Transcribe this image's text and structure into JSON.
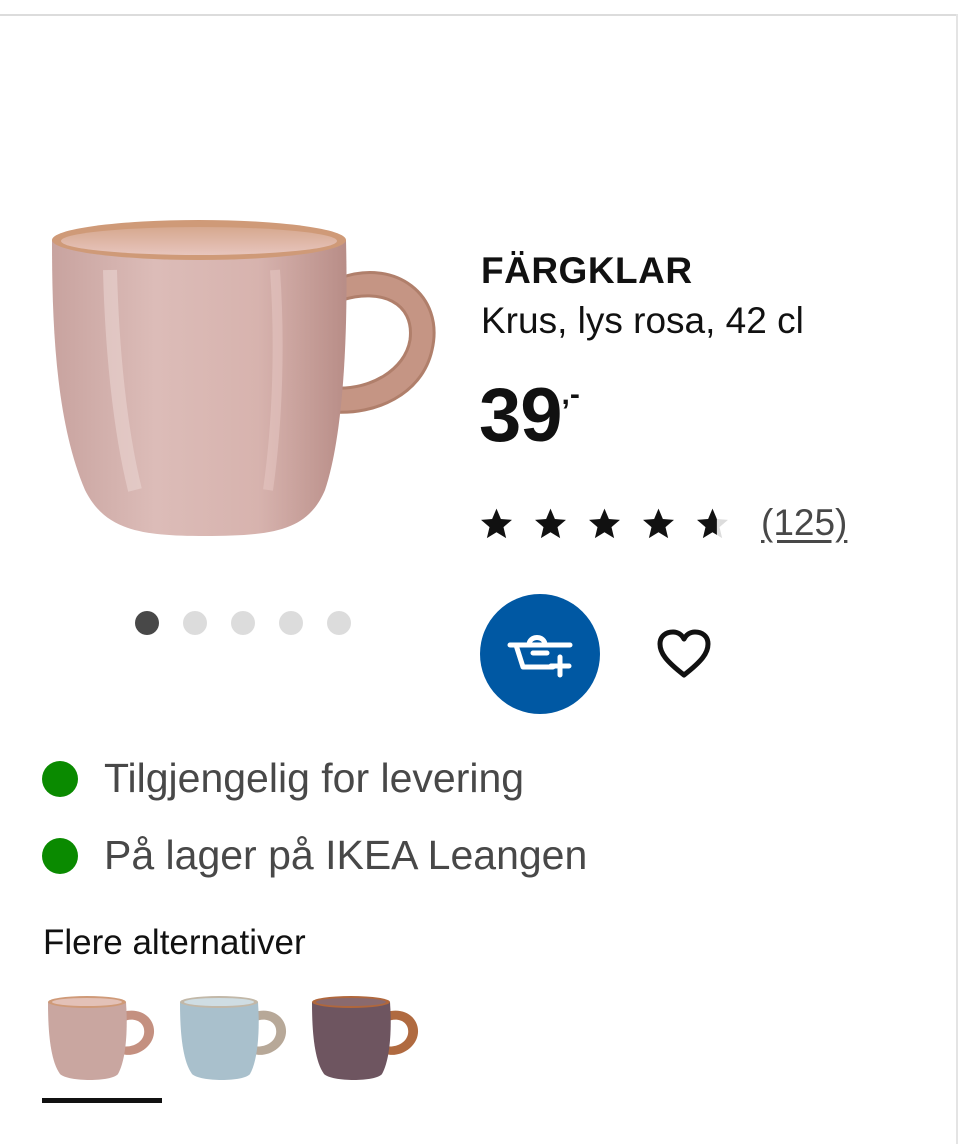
{
  "product": {
    "name": "FÄRGKLAR",
    "description": "Krus, lys rosa, 42 cl",
    "price_integer": "39",
    "price_suffix": ",-",
    "rating": 4.5,
    "rating_max": 5,
    "review_count": "(125)"
  },
  "gallery": {
    "image_count": 5,
    "active_index": 0
  },
  "actions": {
    "add_to_cart_icon": "basket-add-icon",
    "favourite_icon": "heart-icon"
  },
  "availability": [
    {
      "status": "available",
      "text": "Tilgjengelig for levering",
      "color": "#0a8a00"
    },
    {
      "status": "in-stock",
      "text": "På lager på IKEA Leangen",
      "color": "#0a8a00"
    }
  ],
  "alternatives": {
    "title": "Flere alternativer",
    "selected_index": 0,
    "items": [
      {
        "color_name": "lys rosa",
        "color": "#c9a6a0"
      },
      {
        "color_name": "blue",
        "color": "#a9c0cc"
      },
      {
        "color_name": "brown",
        "color": "#6e5560"
      }
    ]
  },
  "colors": {
    "brand_blue": "#0058a3",
    "available_green": "#0a8a00",
    "text_primary": "#111111",
    "text_secondary": "#484848"
  }
}
